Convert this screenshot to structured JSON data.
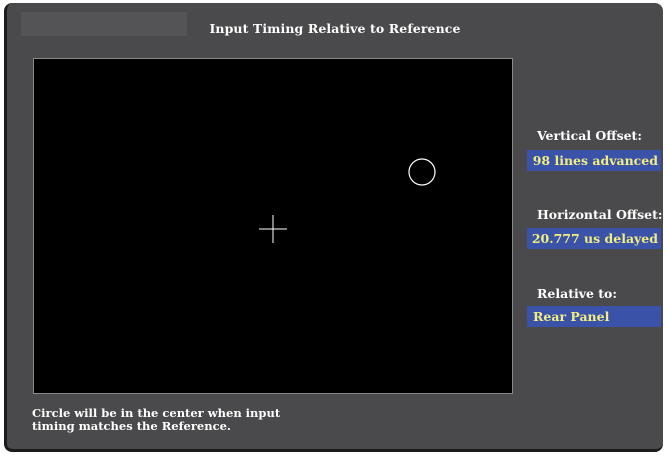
{
  "window": {
    "title": "Input Timing Relative to Reference"
  },
  "vertical_offset": {
    "label": "Vertical Offset:",
    "value": "98 lines advanced"
  },
  "horizontal_offset": {
    "label": "Horizontal Offset:",
    "value": "20.777 us delayed"
  },
  "relative_to": {
    "label": "Relative to:",
    "value": "Rear Panel"
  },
  "footer": {
    "line1": "Circle will be in the center when input",
    "line2": "timing matches the Reference."
  },
  "display": {
    "crosshair_icon": "crosshair-icon",
    "timing_marker_icon": "circle-icon"
  },
  "colors": {
    "panel_background": "#4a4a4c",
    "display_background": "#000000",
    "value_box_background": "#3a52a8",
    "value_text": "#f3ee80",
    "label_text": "#ffffff"
  }
}
